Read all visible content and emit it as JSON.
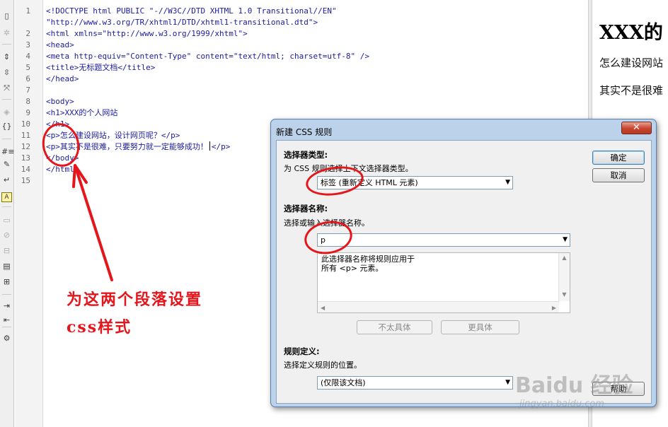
{
  "toolbar": {
    "icons": [
      {
        "name": "document-icon",
        "glyph": "▯"
      },
      {
        "name": "gear-icon",
        "glyph": "✲"
      },
      {
        "name": "collapse-tag-icon",
        "glyph": "⇕"
      },
      {
        "name": "collapse-selection-icon",
        "glyph": "⇳"
      },
      {
        "name": "expand-all-icon",
        "glyph": "⤧"
      },
      {
        "name": "select-parent-tag-icon",
        "glyph": "◈"
      },
      {
        "name": "balance-braces-icon",
        "glyph": "{}"
      },
      {
        "name": "line-numbers-icon",
        "glyph": "#≡"
      },
      {
        "name": "highlight-invalid-icon",
        "glyph": "✎"
      },
      {
        "name": "word-wrap-icon",
        "glyph": "↵"
      },
      {
        "name": "syntax-coloring-icon",
        "glyph": "A"
      },
      {
        "name": "apply-comment-icon",
        "glyph": "▭"
      },
      {
        "name": "remove-comment-icon",
        "glyph": "⊘"
      },
      {
        "name": "wrap-tag-icon",
        "glyph": "⊟"
      },
      {
        "name": "recent-snippets-icon",
        "glyph": "▤"
      },
      {
        "name": "move-css-icon",
        "glyph": "⊞"
      },
      {
        "name": "indent-icon",
        "glyph": "⇥"
      },
      {
        "name": "outdent-icon",
        "glyph": "⇤"
      },
      {
        "name": "format-source-icon",
        "glyph": "⚙"
      }
    ]
  },
  "editor": {
    "line_numbers": [
      "1",
      "2",
      "3",
      "4",
      "5",
      "6",
      "7",
      "8",
      "9",
      "10",
      "11",
      "12",
      "13",
      "14",
      "15"
    ],
    "lines": [
      "<!DOCTYPE html PUBLIC \"-//W3C//DTD XHTML 1.0 Transitional//EN\"",
      "\"http://www.w3.org/TR/xhtml1/DTD/xhtml1-transitional.dtd\">",
      "<html xmlns=\"http://www.w3.org/1999/xhtml\">",
      "<head>",
      "<meta http-equiv=\"Content-Type\" content=\"text/html; charset=utf-8\" />",
      "<title>无标题文档</title>",
      "</head>",
      "",
      "<body>",
      "<h1>XXX的个人网站",
      "</h1>",
      "<p>怎么建设网站，设计网页呢？</p>",
      "<p>其实不是很难，只要努力就一定能够成功！</p>",
      "</body>",
      "</html>"
    ]
  },
  "preview": {
    "heading": "XXX的",
    "para1": "怎么建设网站",
    "para2": "其实不是很难"
  },
  "annotation": {
    "line1": "为这两个段落设置",
    "line2": "css样式"
  },
  "dialog": {
    "title": "新建 CSS 规则",
    "close_glyph": "✕",
    "selector_type_label": "选择器类型:",
    "selector_type_desc": "为 CSS 规则选择上下文选择器类型。",
    "selector_type_value": "标签 (重新定义 HTML 元素)",
    "selector_name_label": "选择器名称:",
    "selector_name_desc": "选择或输入选择器名称。",
    "selector_name_value": "p",
    "info_line1": "此选择器名称将规则应用于",
    "info_line2": "所有 <p> 元素。",
    "less_specific": "不太具体",
    "more_specific": "更具体",
    "rule_def_label": "规则定义:",
    "rule_def_desc": "选择定义规则的位置。",
    "rule_def_value": "(仅限该文档)",
    "ok": "确定",
    "cancel": "取消",
    "help": "帮助"
  },
  "watermark": {
    "logo": "Baidu 经验",
    "url": "jingyan.baidu.com"
  },
  "colors": {
    "annotation_red": "#e4161c",
    "dialog_frame": "#bcd2ea",
    "code_blue": "#1a1aa6"
  }
}
